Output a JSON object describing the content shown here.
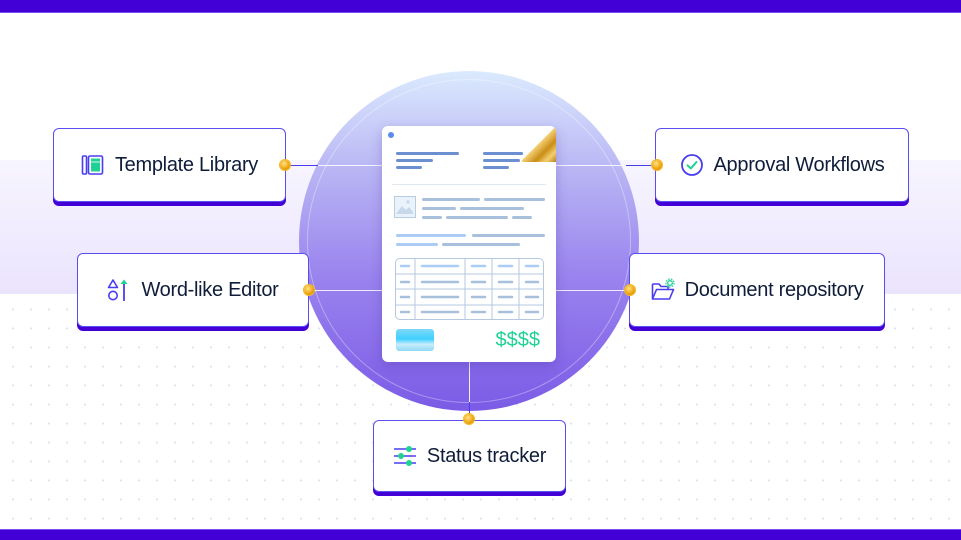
{
  "diagram": {
    "center": {
      "name": "document",
      "price_text": "$$$$"
    },
    "features": [
      {
        "id": "template-library",
        "label": "Template Library",
        "icon": "book-icon"
      },
      {
        "id": "approval-workflows",
        "label": "Approval Workflows",
        "icon": "check-circle-icon"
      },
      {
        "id": "word-like-editor",
        "label": "Word-like Editor",
        "icon": "shapes-text-icon"
      },
      {
        "id": "document-repository",
        "label": "Document repository",
        "icon": "folder-gear-icon"
      },
      {
        "id": "status-tracker",
        "label": "Status tracker",
        "icon": "sliders-icon"
      }
    ]
  },
  "colors": {
    "brand": "#4200d6",
    "accent_green": "#1fd195",
    "text": "#0f1d3a",
    "connector_node": "#f0a80f",
    "circle_top": "#dbeafe",
    "circle_bottom": "#7b5be6"
  }
}
